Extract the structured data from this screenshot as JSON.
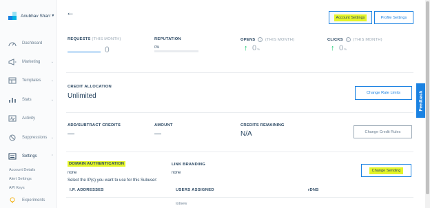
{
  "sidebar": {
    "user_name": "Anubhav Sharr",
    "items": [
      {
        "label": "Dashboard",
        "icon": "speedometer-icon",
        "has_children": false
      },
      {
        "label": "Marketing",
        "icon": "megaphone-icon",
        "has_children": true
      },
      {
        "label": "Templates",
        "icon": "templates-icon",
        "has_children": true
      },
      {
        "label": "Stats",
        "icon": "stats-icon",
        "has_children": true
      },
      {
        "label": "Activity",
        "icon": "activity-icon",
        "has_children": false
      },
      {
        "label": "Suppressions",
        "icon": "suppressions-icon",
        "has_children": true
      },
      {
        "label": "Settings",
        "icon": "settings-icon",
        "has_children": true
      }
    ],
    "sub_items": [
      "Account Details",
      "Alert Settings",
      "API Keys"
    ],
    "footer": {
      "label": "Experiments",
      "icon": "lightbulb-icon"
    }
  },
  "header": {
    "account_settings": "Account Settings",
    "profile_settings": "Profile Settings"
  },
  "stats": {
    "requests": {
      "label": "REQUESTS",
      "period": "(THIS MONTH)",
      "value": "0"
    },
    "reputation": {
      "label": "REPUTATION",
      "value": "0%",
      "percent": 0
    },
    "opens": {
      "label": "OPENS",
      "period": "(THIS MONTH)",
      "value": "0",
      "unit": "%"
    },
    "clicks": {
      "label": "CLICKS",
      "period": "(THIS MONTH)",
      "value": "0",
      "unit": "%"
    }
  },
  "credit_allocation": {
    "label": "CREDIT ALLOCATION",
    "value": "Unlimited",
    "button": "Change Rate Limits"
  },
  "credits_row": {
    "add_subtract": {
      "label": "ADD/SUBTRACT CREDITS",
      "value": "—"
    },
    "amount": {
      "label": "AMOUNT",
      "value": "—"
    },
    "remaining": {
      "label": "CREDITS REMAINING",
      "value": "N/A"
    },
    "button": "Change Credit Rules"
  },
  "domain": {
    "label": "DOMAIN AUTHENTICATION",
    "value": "none",
    "link_branding_label": "LINK BRANDING",
    "link_branding_value": "none",
    "ip_instruction": "Select the IP(s) you want to use for this Subuser:",
    "button": "Change Sending"
  },
  "ip_table": {
    "headers": [
      "I.P. ADDRESSES",
      "USERS ASSIGNED",
      "rDNS"
    ],
    "rows": [
      [
        "",
        "totnew",
        ""
      ]
    ]
  },
  "feedback": "Feedback",
  "colors": {
    "accent": "#1a82e2",
    "highlight": "#e4f528",
    "success": "#18c96e",
    "text": "#294661"
  }
}
